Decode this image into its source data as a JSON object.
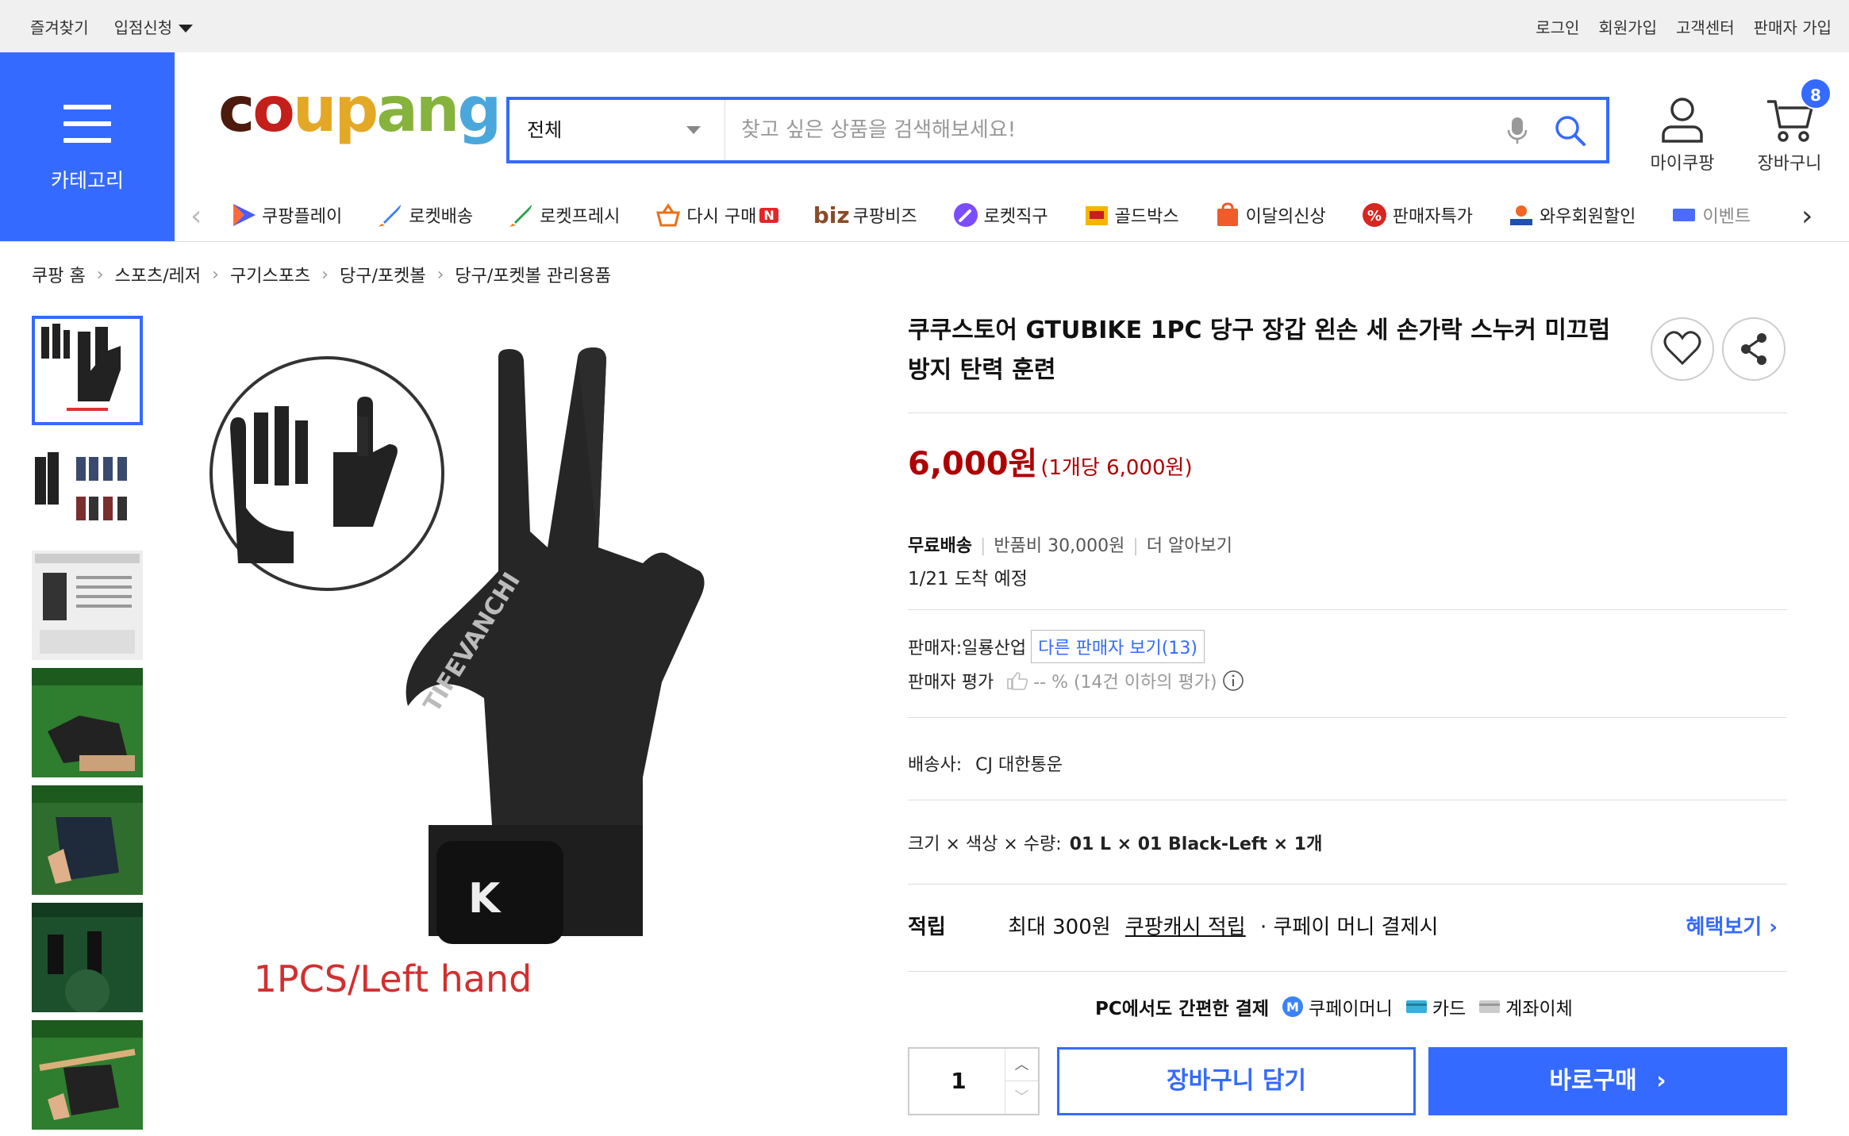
{
  "topbar": {
    "favorites": "즐겨찾기",
    "store_apply": "입점신청",
    "login": "로그인",
    "signup": "회원가입",
    "customer_center": "고객센터",
    "seller_signup": "판매자 가입"
  },
  "header": {
    "category_label": "카테고리",
    "logo": "coupang",
    "search_category": "전체",
    "search_placeholder": "찾고 싶은 상품을 검색해보세요!",
    "my_coupang": "마이쿠팡",
    "cart": "장바구니",
    "cart_count": "8"
  },
  "nav": {
    "items": [
      {
        "label": "쿠팡플레이",
        "icon": "play-icon"
      },
      {
        "label": "로켓배송",
        "icon": "rocket-icon"
      },
      {
        "label": "로켓프레시",
        "icon": "fresh-rocket-icon"
      },
      {
        "label": "다시 구매",
        "icon": "basket-icon"
      },
      {
        "label": "쿠팡비즈",
        "icon": "biz-icon"
      },
      {
        "label": "로켓직구",
        "icon": "global-rocket-icon"
      },
      {
        "label": "골드박스",
        "icon": "gold-box-icon"
      },
      {
        "label": "이달의신상",
        "icon": "new-bag-icon"
      },
      {
        "label": "판매자특가",
        "icon": "discount-icon"
      },
      {
        "label": "와우회원할인",
        "icon": "wow-icon"
      },
      {
        "label": "이벤트",
        "icon": "event-icon"
      }
    ],
    "biz_prefix": "biz",
    "new_badge": "N"
  },
  "breadcrumb": [
    "쿠팡 홈",
    "스포츠/레저",
    "구기스포츠",
    "당구/포켓볼",
    "당구/포켓볼 관리용품"
  ],
  "product": {
    "title": "쿠쿠스토어 GTUBIKE 1PC 당구 장갑 왼손 세 손가락 스누커 미끄럼 방지 탄력 훈련",
    "image_caption": "1PCS/Left hand",
    "price": "6,000원",
    "unit_price": "(1개당 6,000원)",
    "shipping_free": "무료배송",
    "return_fee": "반품비 30,000원",
    "learn_more": "더 알아보기",
    "arrival": "1/21 도착 예정",
    "seller_label": "판매자:",
    "seller_name": "일룡산업",
    "other_sellers": "다른 판매자 보기(13)",
    "seller_rating_label": "판매자 평가",
    "seller_rating_value": "-- % (14건 이하의 평가)",
    "courier_label": "배송사:",
    "courier_name": "CJ 대한통운",
    "option_label": "크기 × 색상 × 수량:",
    "option_value": "01 L × 01 Black-Left × 1개",
    "reward_label": "적립",
    "reward_prefix": "최대 300원",
    "reward_link": "쿠팡캐시 적립",
    "reward_suffix": "· 쿠페이 머니 결제시",
    "reward_more": "혜택보기",
    "pay_title": "PC에서도 간편한 결제",
    "pay_methods": [
      "쿠페이머니",
      "카드",
      "계좌이체"
    ],
    "quantity": "1",
    "add_to_cart": "장바구니 담기",
    "buy_now": "바로구매"
  }
}
